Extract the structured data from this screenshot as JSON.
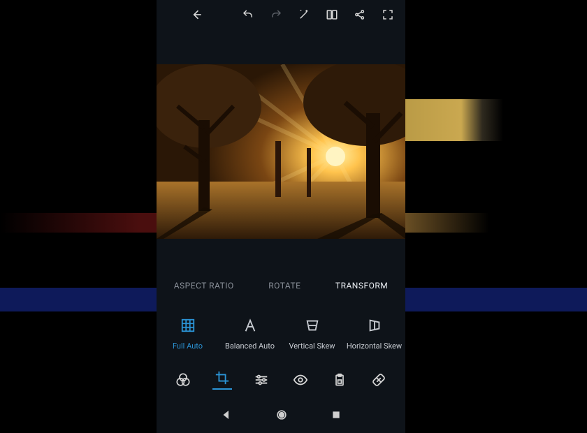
{
  "colors": {
    "accent": "#2b94d6",
    "bg": "#0e1319",
    "muted": "#8a9099",
    "text": "#e6e6e6"
  },
  "topbar": {
    "icons": [
      "back-arrow",
      "undo",
      "redo",
      "magic-wand",
      "compare",
      "share",
      "fullscreen"
    ]
  },
  "tabs": [
    {
      "label": "ASPECT RATIO",
      "active": false
    },
    {
      "label": "ROTATE",
      "active": false
    },
    {
      "label": "TRANSFORM",
      "active": true
    }
  ],
  "transform_tools": [
    {
      "icon": "grid",
      "label": "Full Auto",
      "active": true
    },
    {
      "icon": "letter-a",
      "label": "Balanced Auto",
      "active": false
    },
    {
      "icon": "vertical-skew",
      "label": "Vertical Skew",
      "active": false
    },
    {
      "icon": "horizontal-skew",
      "label": "Horizontal Skew",
      "active": false
    }
  ],
  "mode_bar": [
    {
      "icon": "presets",
      "active": false
    },
    {
      "icon": "crop",
      "active": true
    },
    {
      "icon": "adjust",
      "active": false
    },
    {
      "icon": "eye",
      "active": false
    },
    {
      "icon": "clipboard",
      "active": false
    },
    {
      "icon": "heal",
      "active": false
    }
  ],
  "system_nav": [
    "back",
    "home",
    "recent"
  ],
  "image": {
    "description": "autumn forest at sunset with sunbeams through trees"
  }
}
